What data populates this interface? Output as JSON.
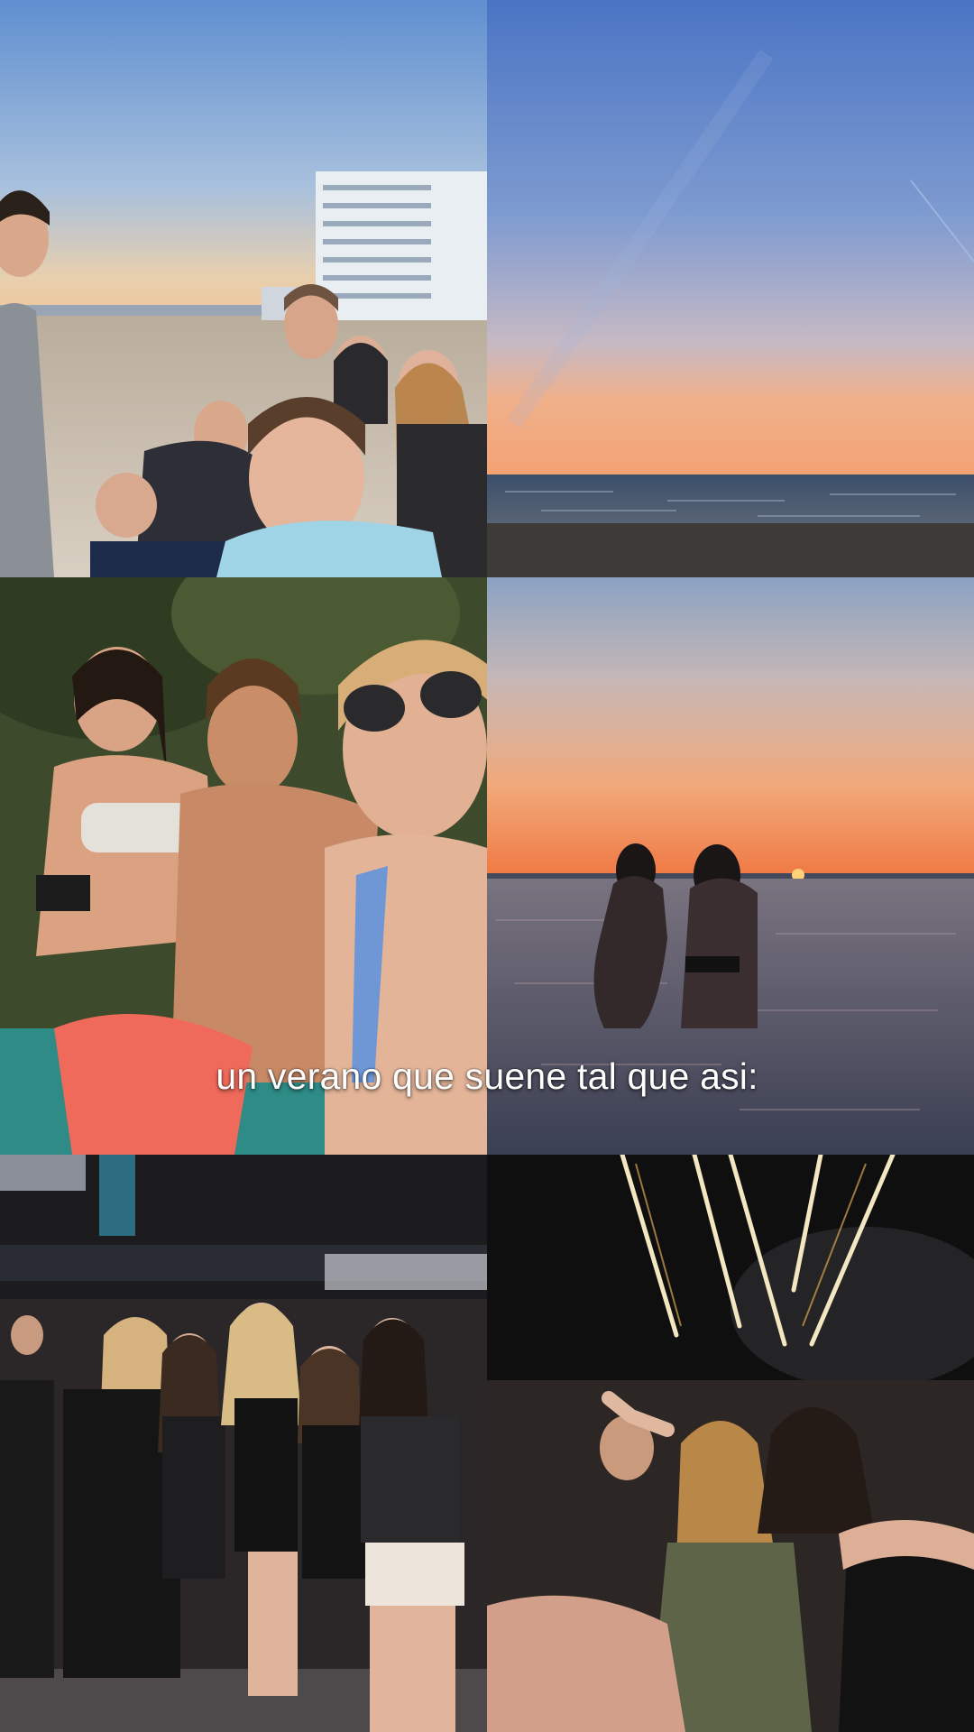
{
  "caption": {
    "text": "un verano que suene tal que asi:"
  },
  "tiles": [
    {
      "name": "beach-selfie-group"
    },
    {
      "name": "sunset-over-sea"
    },
    {
      "name": "three-friends-selfie"
    },
    {
      "name": "two-girls-in-sea-at-sunset"
    },
    {
      "name": "nightclub-group-photo"
    },
    {
      "name": "fireworks-night-friends"
    }
  ],
  "colors": {
    "caption_text": "#ffffff",
    "sky_blue": "#5f86c7",
    "sunset_orange": "#f0a070",
    "sea": "#3c4f6a",
    "night": "#111111"
  }
}
